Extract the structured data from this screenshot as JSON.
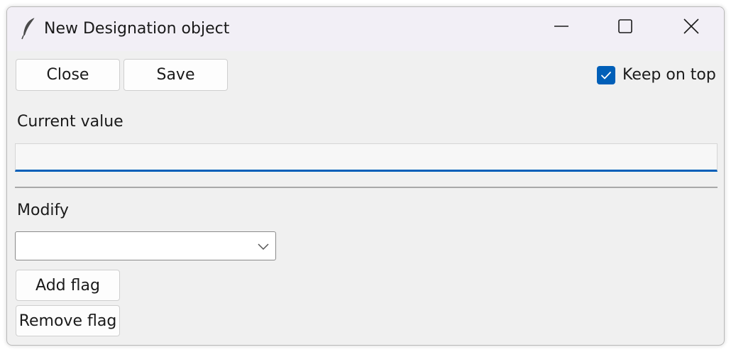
{
  "window": {
    "title": "New Designation object",
    "controls": {
      "minimize_icon": "minimize-icon",
      "maximize_icon": "maximize-icon",
      "close_icon": "close-icon"
    },
    "app_icon": "feather-icon"
  },
  "toolbar": {
    "close_label": "Close",
    "save_label": "Save",
    "keep_on_top_label": "Keep on top",
    "keep_on_top_checked": true
  },
  "current_value": {
    "label": "Current value",
    "value": ""
  },
  "modify": {
    "label": "Modify",
    "selected": "",
    "add_flag_label": "Add flag",
    "remove_flag_label": "Remove flag"
  },
  "colors": {
    "accent": "#005fb8",
    "titlebar": "#f2eff6",
    "window_bg": "#f0f0f0"
  }
}
